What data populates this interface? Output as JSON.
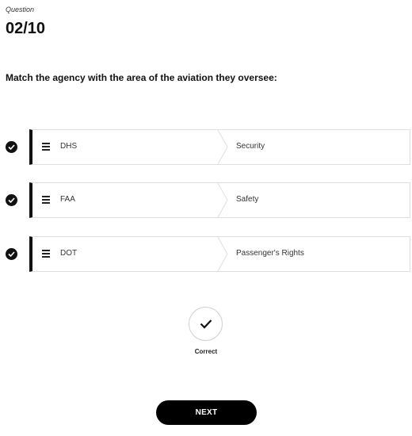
{
  "question": {
    "label": "Question",
    "counter": "02/10",
    "prompt": "Match the agency with the area of the aviation they oversee:"
  },
  "matches": [
    {
      "agency": "DHS",
      "area": "Security",
      "status": "correct",
      "icon": "check-circle-icon"
    },
    {
      "agency": "FAA",
      "area": "Safety",
      "status": "correct",
      "icon": "check-circle-icon"
    },
    {
      "agency": "DOT",
      "area": "Passenger's Rights",
      "status": "correct",
      "icon": "check-circle-icon"
    }
  ],
  "result": {
    "label": "Correct",
    "icon": "checkmark-icon"
  },
  "actions": {
    "next_label": "NEXT"
  },
  "colors": {
    "accent": "#000000",
    "card_border": "#dedede",
    "text": "#333333"
  }
}
